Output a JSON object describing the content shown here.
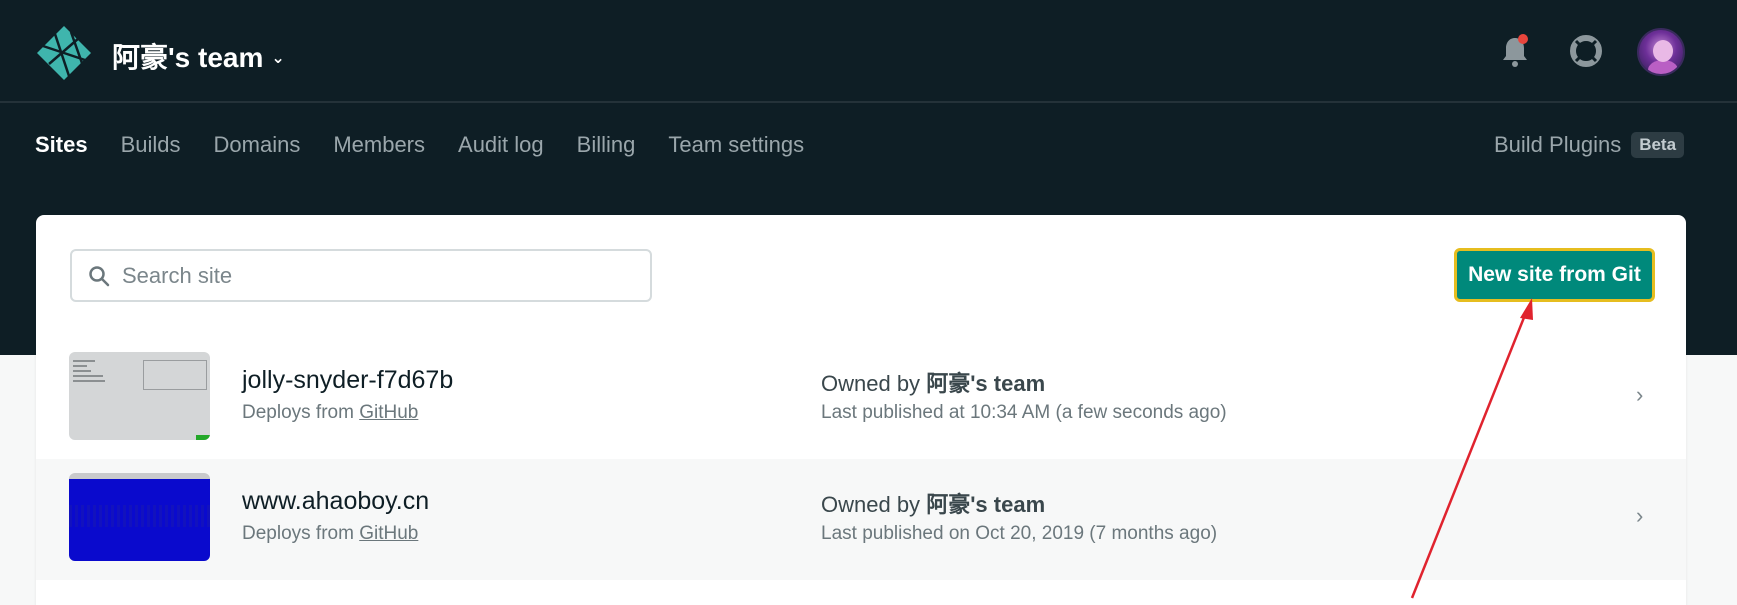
{
  "header": {
    "team_name": "阿豪's team",
    "nav": [
      {
        "label": "Sites",
        "active": true
      },
      {
        "label": "Builds"
      },
      {
        "label": "Domains"
      },
      {
        "label": "Members"
      },
      {
        "label": "Audit log"
      },
      {
        "label": "Billing"
      },
      {
        "label": "Team settings"
      }
    ],
    "build_plugins_label": "Build Plugins",
    "build_plugins_badge": "Beta"
  },
  "toolbar": {
    "search_placeholder": "Search site",
    "new_site_label": "New site from Git"
  },
  "sites": [
    {
      "name": "jolly-snyder-f7d67b",
      "deploys_prefix": "Deploys from",
      "deploys_source": "GitHub",
      "owned_prefix": "Owned by",
      "owner": "阿豪's team",
      "published": "Last published at 10:34 AM (a few seconds ago)"
    },
    {
      "name": "www.ahaoboy.cn",
      "deploys_prefix": "Deploys from",
      "deploys_source": "GitHub",
      "owned_prefix": "Owned by",
      "owner": "阿豪's team",
      "published": "Last published on Oct 20, 2019 (7 months ago)"
    }
  ],
  "colors": {
    "header_bg": "#0e1e25",
    "primary_button": "#00897b",
    "highlight_border": "#e6bd1f",
    "annotation_arrow": "#e0232e"
  },
  "icons": [
    "netlify-logo-icon",
    "chevron-down-icon",
    "bell-icon",
    "help-lifebuoy-icon",
    "search-icon",
    "chevron-right-icon"
  ]
}
